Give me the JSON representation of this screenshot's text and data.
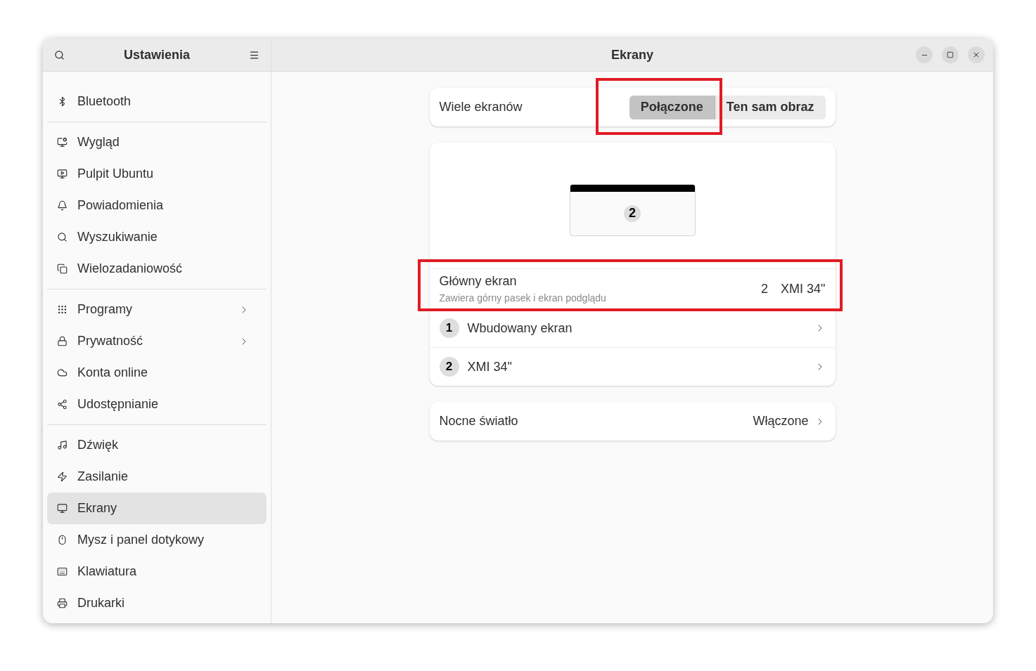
{
  "sidebar": {
    "title": "Ustawienia",
    "sections": [
      [
        {
          "label": "Bluetooth",
          "selected": false,
          "has_submenu": false
        }
      ],
      [
        {
          "label": "Wygląd",
          "selected": false,
          "has_submenu": false
        },
        {
          "label": "Pulpit Ubuntu",
          "selected": false,
          "has_submenu": false
        },
        {
          "label": "Powiadomienia",
          "selected": false,
          "has_submenu": false
        },
        {
          "label": "Wyszukiwanie",
          "selected": false,
          "has_submenu": false
        },
        {
          "label": "Wielozadaniowość",
          "selected": false,
          "has_submenu": false
        }
      ],
      [
        {
          "label": "Programy",
          "selected": false,
          "has_submenu": true
        },
        {
          "label": "Prywatność",
          "selected": false,
          "has_submenu": true
        },
        {
          "label": "Konta online",
          "selected": false,
          "has_submenu": false
        },
        {
          "label": "Udostępnianie",
          "selected": false,
          "has_submenu": false
        }
      ],
      [
        {
          "label": "Dźwięk",
          "selected": false,
          "has_submenu": false
        },
        {
          "label": "Zasilanie",
          "selected": false,
          "has_submenu": false
        },
        {
          "label": "Ekrany",
          "selected": true,
          "has_submenu": false
        },
        {
          "label": "Mysz i panel dotykowy",
          "selected": false,
          "has_submenu": false
        },
        {
          "label": "Klawiatura",
          "selected": false,
          "has_submenu": false
        },
        {
          "label": "Drukarki",
          "selected": false,
          "has_submenu": false
        }
      ]
    ]
  },
  "window": {
    "title": "Ekrany"
  },
  "multi_display": {
    "label": "Wiele ekranów",
    "options": [
      {
        "label": "Połączone",
        "selected": true
      },
      {
        "label": "Ten sam obraz",
        "selected": false
      }
    ]
  },
  "arrangement": {
    "displays": [
      {
        "number": "2"
      }
    ]
  },
  "primary_display": {
    "title": "Główny ekran",
    "subtitle": "Zawiera górny pasek i ekran podglądu",
    "number": "2",
    "name": "XMI 34\""
  },
  "displays": [
    {
      "number": "1",
      "name": "Wbudowany ekran"
    },
    {
      "number": "2",
      "name": "XMI 34\""
    }
  ],
  "night_light": {
    "label": "Nocne światło",
    "value": "Włączone"
  },
  "annotations": [
    {
      "kind": "frame"
    },
    {
      "kind": "frame"
    }
  ]
}
